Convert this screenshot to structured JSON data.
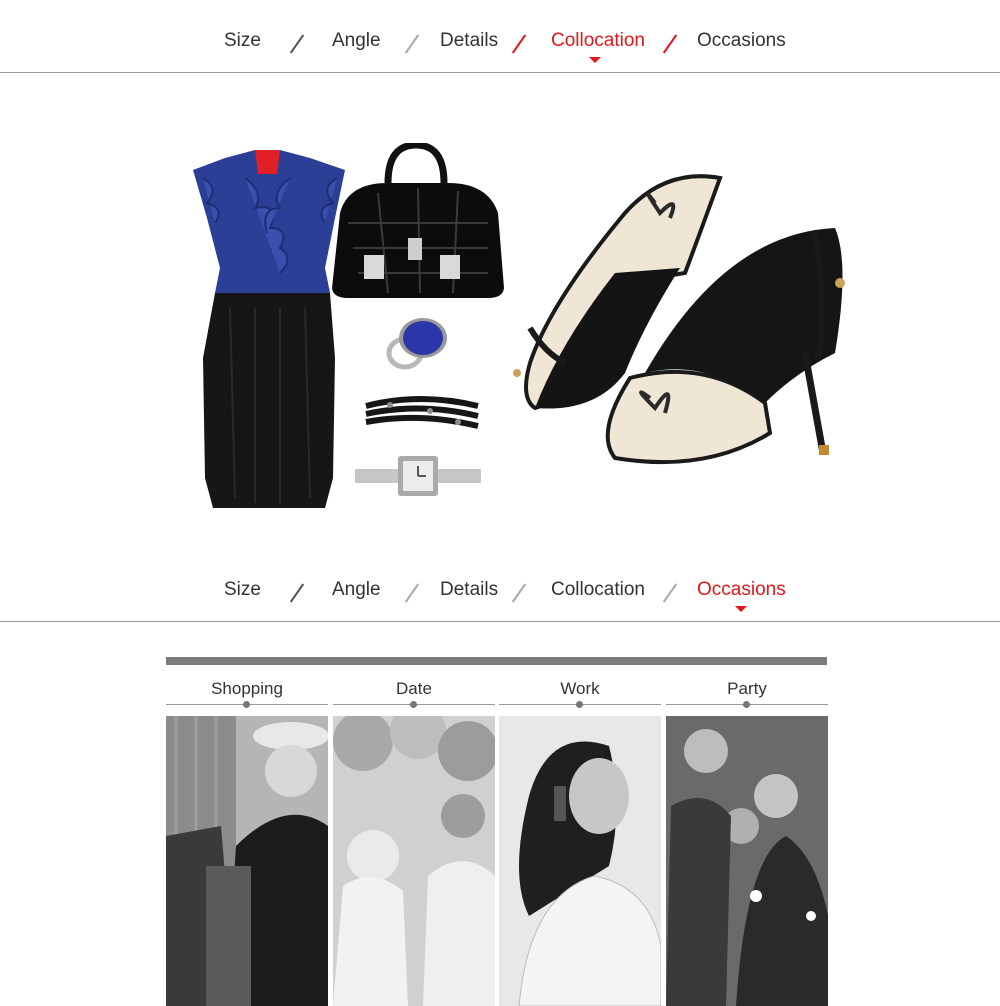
{
  "nav_top": {
    "tabs": [
      "Size",
      "Angle",
      "Details",
      "Collocation",
      "Occasions"
    ],
    "active": "Collocation"
  },
  "nav_bottom": {
    "tabs": [
      "Size",
      "Angle",
      "Details",
      "Collocation",
      "Occasions"
    ],
    "active": "Occasions"
  },
  "collocation": {
    "items": [
      "blue-ruffle-blouse",
      "black-pencil-skirt",
      "black-patent-handbag",
      "blue-stone-ring",
      "beaded-wrap-bracelet",
      "silver-mesh-watch",
      "beige-bow-slingback-heels"
    ]
  },
  "occasions": {
    "labels": [
      "Shopping",
      "Date",
      "Work",
      "Party"
    ]
  },
  "colors": {
    "accent": "#e4161b",
    "text": "#333333",
    "rule": "#9a9a9a",
    "bar": "#7b7b7b"
  }
}
